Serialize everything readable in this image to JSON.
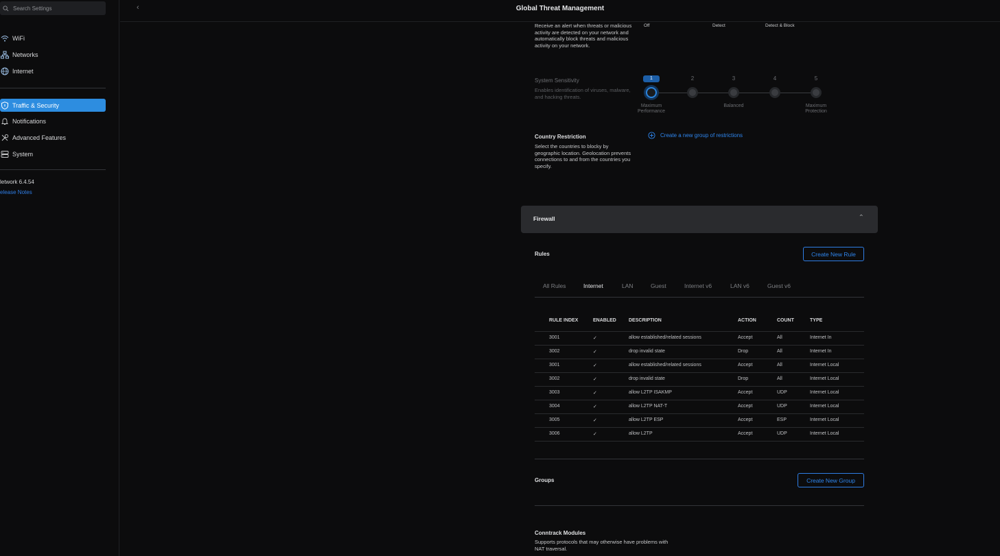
{
  "sidebar": {
    "search_placeholder": "Search Settings",
    "items": [
      {
        "label": "WiFi",
        "icon": "wifi-icon"
      },
      {
        "label": "Networks",
        "icon": "networks-icon"
      },
      {
        "label": "Internet",
        "icon": "globe-icon"
      },
      {
        "label": "Traffic & Security",
        "icon": "shield-icon",
        "active": true
      },
      {
        "label": "Notifications",
        "icon": "bell-icon"
      },
      {
        "label": "Advanced Features",
        "icon": "tools-icon"
      },
      {
        "label": "System",
        "icon": "server-icon"
      }
    ],
    "version": "letwork 6.4.54",
    "release_notes": "elease Notes"
  },
  "header": {
    "title": "Global Threat Management",
    "back_icon": "chevron-left-icon"
  },
  "threat": {
    "alert_desc": "Receive an alert when threats or malicious activity are detected on your network and automatically block threats and malicious activity on your network.",
    "modes": [
      "Off",
      "Detect",
      "Detect & Block"
    ]
  },
  "sensitivity": {
    "label": "System Sensitivity",
    "desc": "Enables identification of viruses, malware, and hacking threats.",
    "steps": [
      "1",
      "2",
      "3",
      "4",
      "5"
    ],
    "selected_step": 1,
    "caption_left": "Maximum Performance",
    "caption_mid": "Balanced",
    "caption_right": "Maximum Protection"
  },
  "country": {
    "label": "Country Restriction",
    "desc": "Select the countries to blocky by geographic location. Geolocation prevents connections to and from the countries you specify.",
    "create_link": "Create a new group of restrictions"
  },
  "firewall": {
    "title": "Firewall",
    "rules_label": "Rules",
    "create_rule": "Create New Rule",
    "tabs": [
      "All Rules",
      "Internet",
      "LAN",
      "Guest",
      "Internet v6",
      "LAN v6",
      "Guest v6"
    ],
    "active_tab": "Internet",
    "columns": [
      "RULE INDEX",
      "ENABLED",
      "DESCRIPTION",
      "ACTION",
      "COUNT",
      "TYPE"
    ],
    "rows": [
      {
        "index": "3001",
        "enabled": "✓",
        "desc": "allow established/related sessions",
        "action": "Accept",
        "count": "All",
        "type": "Internet In"
      },
      {
        "index": "3002",
        "enabled": "✓",
        "desc": "drop invalid state",
        "action": "Drop",
        "count": "All",
        "type": "Internet In"
      },
      {
        "index": "3001",
        "enabled": "✓",
        "desc": "allow established/related sessions",
        "action": "Accept",
        "count": "All",
        "type": "Internet Local"
      },
      {
        "index": "3002",
        "enabled": "✓",
        "desc": "drop invalid state",
        "action": "Drop",
        "count": "All",
        "type": "Internet Local"
      },
      {
        "index": "3003",
        "enabled": "✓",
        "desc": "allow L2TP ISAKMP",
        "action": "Accept",
        "count": "UDP",
        "type": "Internet Local"
      },
      {
        "index": "3004",
        "enabled": "✓",
        "desc": "allow L2TP NAT-T",
        "action": "Accept",
        "count": "UDP",
        "type": "Internet Local"
      },
      {
        "index": "3005",
        "enabled": "✓",
        "desc": "allow L2TP ESP",
        "action": "Accept",
        "count": "ESP",
        "type": "Internet Local"
      },
      {
        "index": "3006",
        "enabled": "✓",
        "desc": "allow L2TP",
        "action": "Accept",
        "count": "UDP",
        "type": "Internet Local"
      }
    ],
    "groups_label": "Groups",
    "create_group": "Create New Group",
    "conntrack_label": "Conntrack Modules",
    "conntrack_desc": "Supports protocols that may otherwise have problems with NAT traversal."
  },
  "colors": {
    "accent": "#2d8de0",
    "link": "#2f86ee",
    "panel": "#2a2b2e",
    "background": "#0c0c0d"
  }
}
